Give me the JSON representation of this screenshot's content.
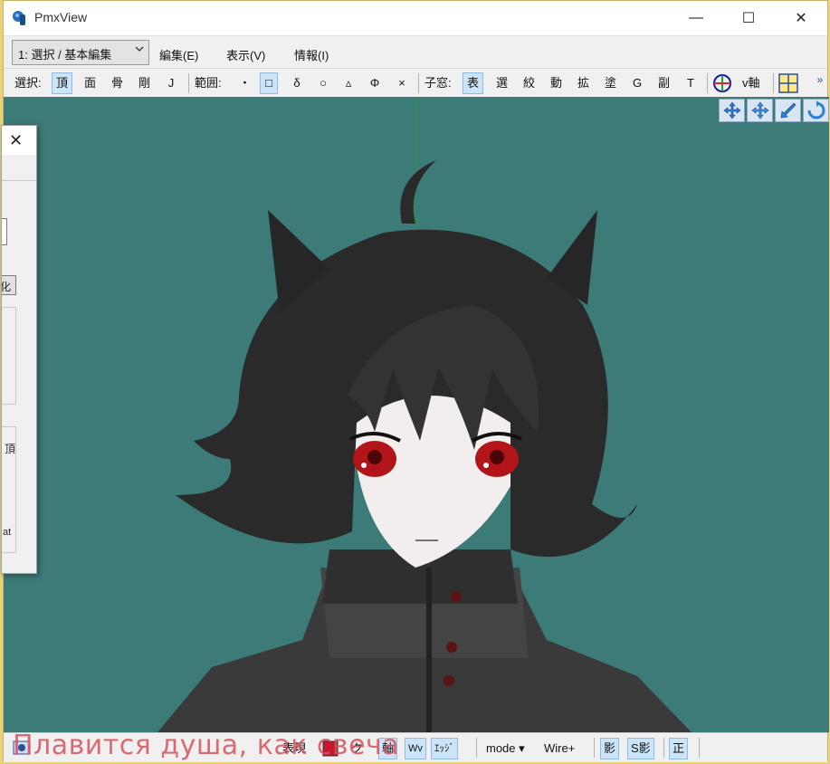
{
  "window": {
    "title": "PmxView",
    "minimize_glyph": "—",
    "maximize_glyph": "☐",
    "close_glyph": "✕"
  },
  "menubar": {
    "mode_select": "1: 選択 / 基本編集",
    "menus": [
      "編集(E)",
      "表示(V)",
      "情報(I)"
    ]
  },
  "toolbar": {
    "select_label": "選択:",
    "select_items": [
      "頂",
      "面",
      "骨",
      "剛",
      "J"
    ],
    "range_label": "範囲:",
    "range_items": [
      "・",
      "□",
      "δ",
      "○",
      "▵",
      "Φ",
      "×"
    ],
    "child_label": "子窓:",
    "child_items": [
      "表",
      "選",
      "絞",
      "動",
      "拡",
      "塗",
      "G",
      "副",
      "T"
    ],
    "vaxis_label": "v軸",
    "overflow_glyph": "»"
  },
  "dialog": {
    "close_glyph": "✕",
    "partial_texts": [
      "化",
      "頂",
      "at"
    ]
  },
  "bottombar": {
    "items": [
      "表現",
      "ク",
      "軸",
      "Wv",
      "ｴｯｼﾞ",
      "mode",
      "Wire+",
      "影",
      "S影",
      "正"
    ],
    "mode_caret": "▾"
  },
  "overlay_caption": "Плавится душа, как свеча",
  "colors": {
    "viewport_bg": "#3c7b78",
    "axis_green": "#1e9a3a",
    "active_button": "#cce4f7",
    "caption_red": "#d6535f"
  }
}
